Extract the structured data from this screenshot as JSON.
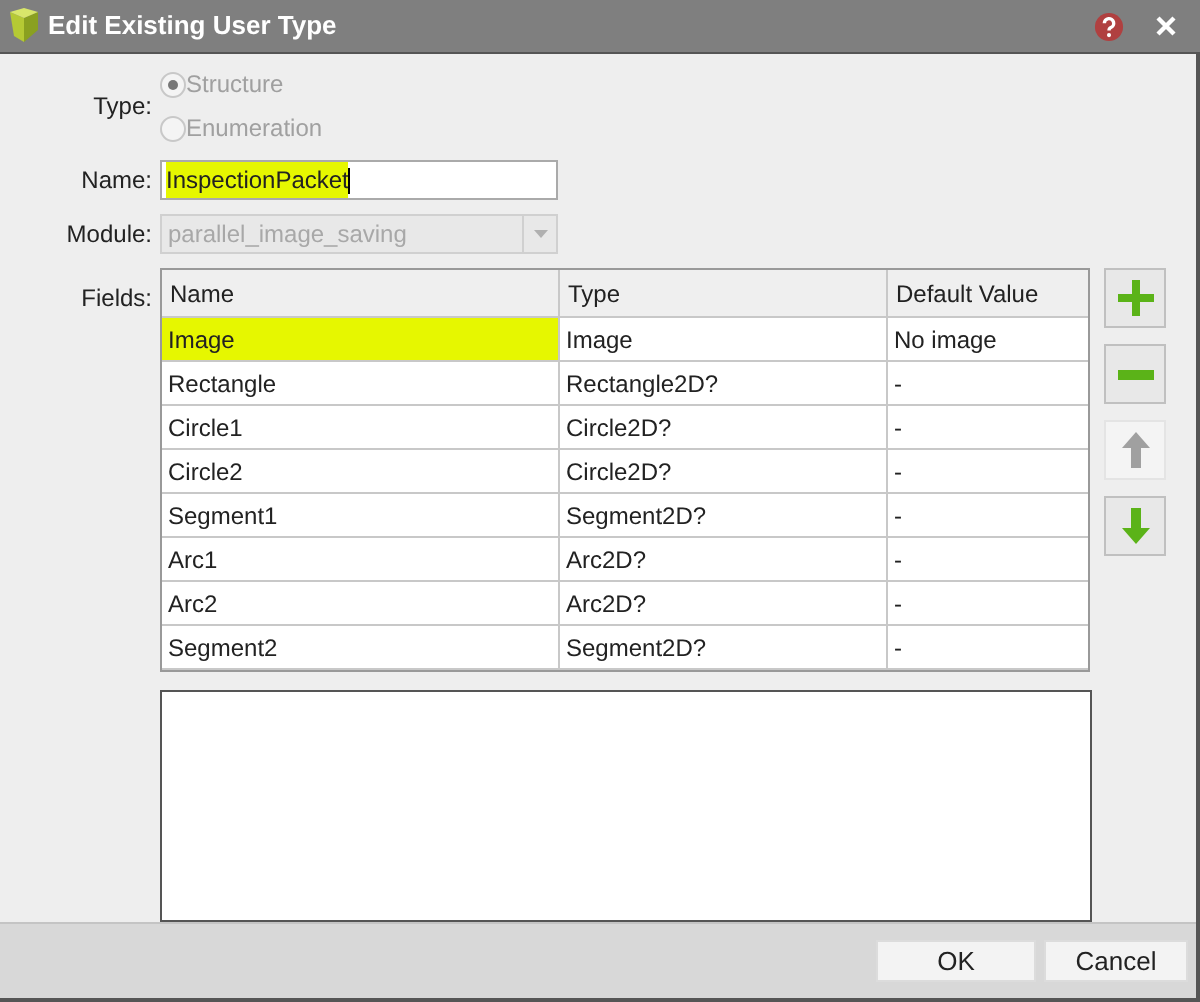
{
  "window": {
    "title": "Edit Existing User Type"
  },
  "type": {
    "label": "Type:",
    "disabled": true,
    "options": [
      {
        "label": "Structure",
        "selected": true
      },
      {
        "label": "Enumeration",
        "selected": false
      }
    ]
  },
  "name": {
    "label": "Name:",
    "value": "InspectionPacket"
  },
  "module": {
    "label": "Module:",
    "value": "parallel_image_saving",
    "disabled": true
  },
  "fields": {
    "label": "Fields:",
    "columns": [
      "Name",
      "Type",
      "Default Value"
    ],
    "rows": [
      {
        "cells": [
          "Image",
          "Image",
          "No image"
        ],
        "selected": true
      },
      {
        "cells": [
          "Rectangle",
          "Rectangle2D?",
          "-"
        ],
        "selected": false
      },
      {
        "cells": [
          "Circle1",
          "Circle2D?",
          "-"
        ],
        "selected": false
      },
      {
        "cells": [
          "Circle2",
          "Circle2D?",
          "-"
        ],
        "selected": false
      },
      {
        "cells": [
          "Segment1",
          "Segment2D?",
          "-"
        ],
        "selected": false
      },
      {
        "cells": [
          "Arc1",
          "Arc2D?",
          "-"
        ],
        "selected": false
      },
      {
        "cells": [
          "Arc2",
          "Arc2D?",
          "-"
        ],
        "selected": false
      },
      {
        "cells": [
          "Segment2",
          "Segment2D?",
          "-"
        ],
        "selected": false
      }
    ],
    "tools": [
      {
        "kind": "add",
        "disabled": false
      },
      {
        "kind": "remove",
        "disabled": false
      },
      {
        "kind": "up",
        "disabled": true
      },
      {
        "kind": "down",
        "disabled": false
      }
    ]
  },
  "buttons": [
    "OK",
    "Cancel"
  ]
}
